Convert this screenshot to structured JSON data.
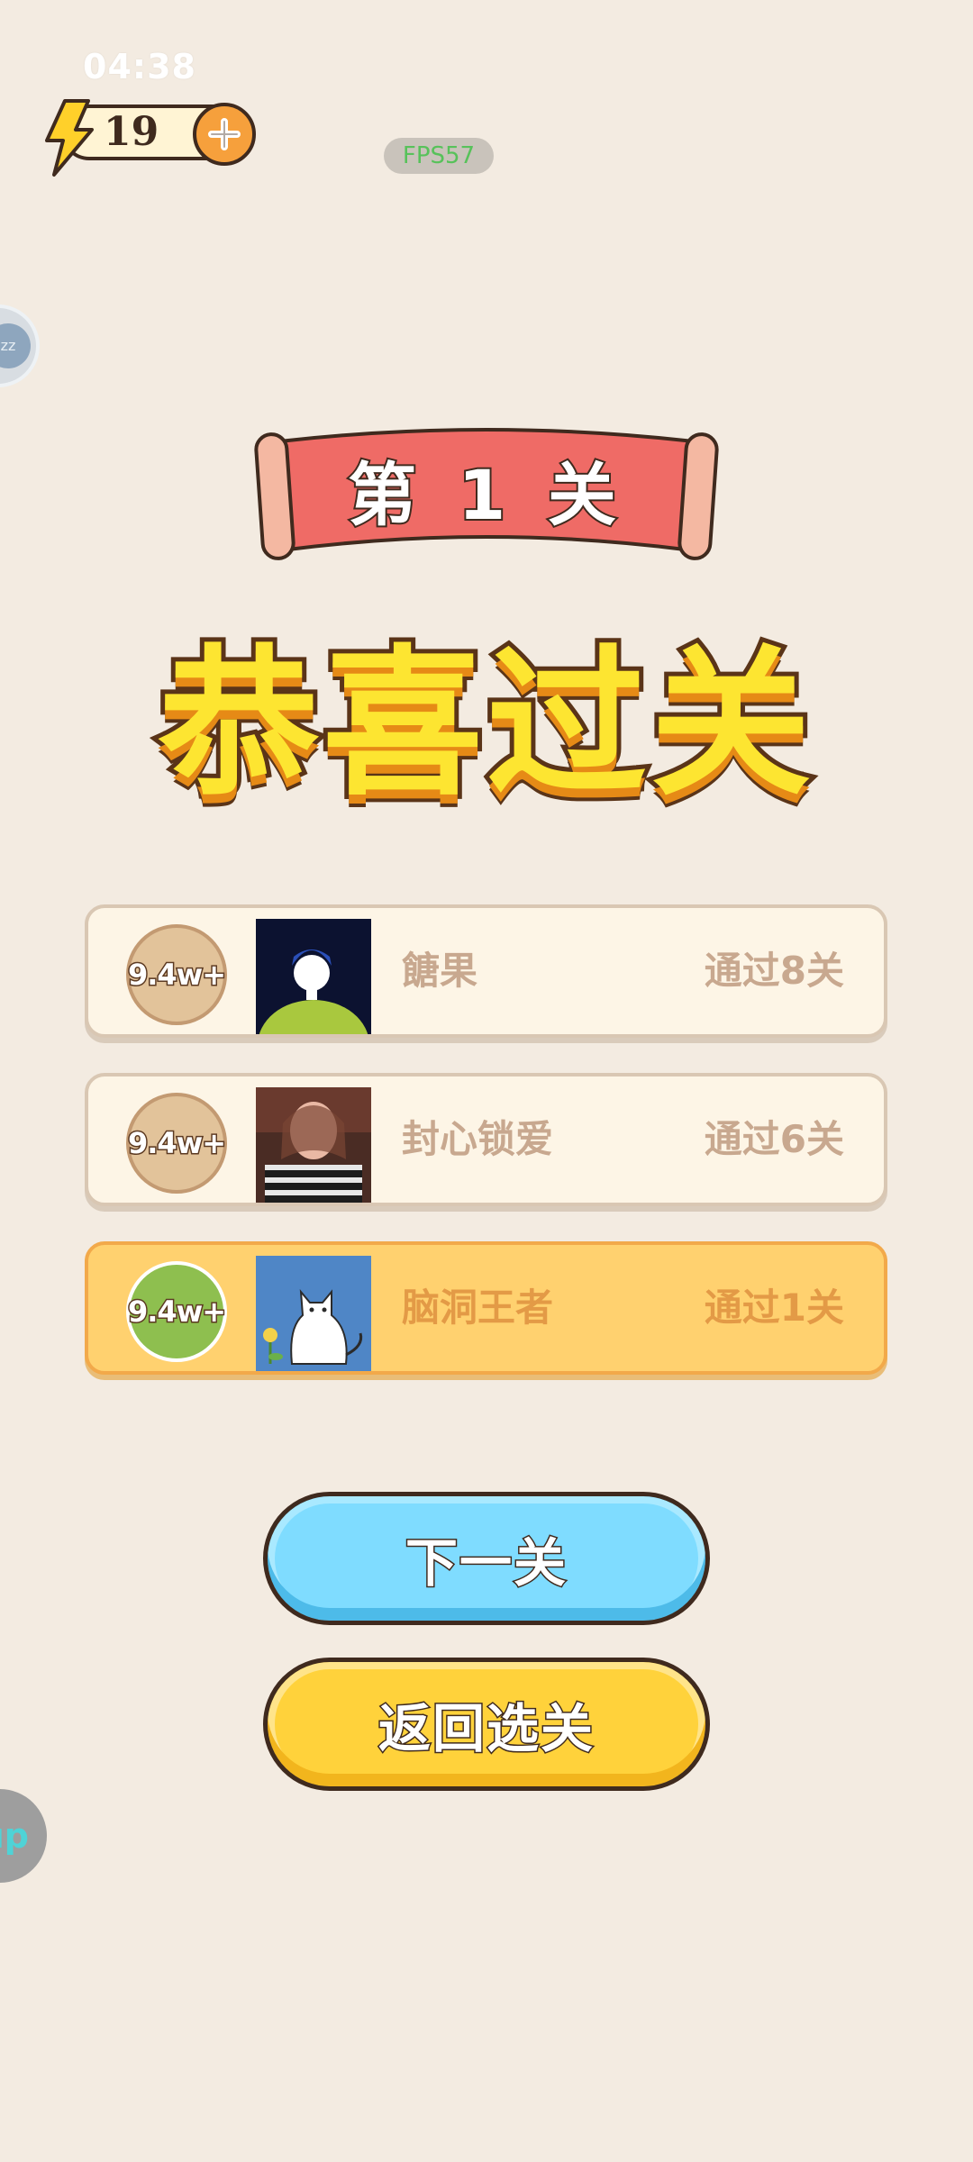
{
  "status": {
    "time": "04:38",
    "fps": "FPS57"
  },
  "energy": {
    "count": "19"
  },
  "side_buttons": {
    "top_label": "zz",
    "bottom_label": "up"
  },
  "level": {
    "label": "第 1 关"
  },
  "title": "恭喜过关",
  "ranking": [
    {
      "badge": "9.4w+",
      "name": "餹果",
      "progress": "通过8关",
      "is_me": false
    },
    {
      "badge": "9.4w+",
      "name": "封心锁爱",
      "progress": "通过6关",
      "is_me": false
    },
    {
      "badge": "9.4w+",
      "name": "脑洞王者",
      "progress": "通过1关",
      "is_me": true
    }
  ],
  "buttons": {
    "next": "下一关",
    "back": "返回选关"
  },
  "colors": {
    "background": "#f3ebe1",
    "banner": "#ef6b66",
    "title": "#fde531",
    "next_button": "#7fdcff",
    "back_button": "#ffd23b",
    "highlight_row": "#ffd16f"
  }
}
